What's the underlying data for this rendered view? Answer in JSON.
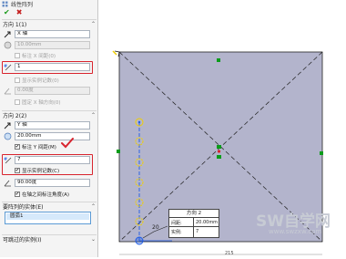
{
  "property_manager": {
    "title": "线性阵列",
    "ok_icon": "check-icon",
    "cancel_icon": "close-icon",
    "direction1": {
      "header": "方向 1(1)",
      "edge_value": "X 轴",
      "spacing_value": "10.00mm",
      "label_x_spacing": "标注 X 间距(0)",
      "instances_value": "1",
      "show_instance_count": "显示实例记数(0)",
      "angle_value": "0.00度",
      "fixed_x_direction": "固定 X 轴方向(0)"
    },
    "direction2": {
      "header": "方向 2(2)",
      "edge_value": "Y 轴",
      "spacing_value": "20.00mm",
      "label_y_spacing": "标注 Y 间距(M)",
      "instances_value": "7",
      "show_instance_count": "显示实例记数(C)",
      "angle_value": "90.00度",
      "label_angle": "在轴之间标注角度(A)"
    },
    "entities_section": {
      "header": "要阵列的实体(E)",
      "item": "圆弧1"
    },
    "skip_section": {
      "header": "可跳过的实例(I)"
    }
  },
  "canvas": {
    "callout": {
      "title": "方向 2",
      "spacing_label": "间距:",
      "spacing_value": "20.00mm",
      "instances_label": "实例:",
      "instances_value": "7"
    },
    "dimension_label": "20",
    "bottom_dimension": "215",
    "watermark_text": "SW自学网",
    "watermark_url": "www.swzxw.com"
  },
  "colors": {
    "rectangle_fill": "#b3b4cc",
    "sketch_line": "#1f1f1f",
    "selected_blue": "#1e5be6",
    "highlight_red": "#d8242e",
    "relation_green": "#0a9c1a",
    "instance_yellow": "#f0d000"
  }
}
